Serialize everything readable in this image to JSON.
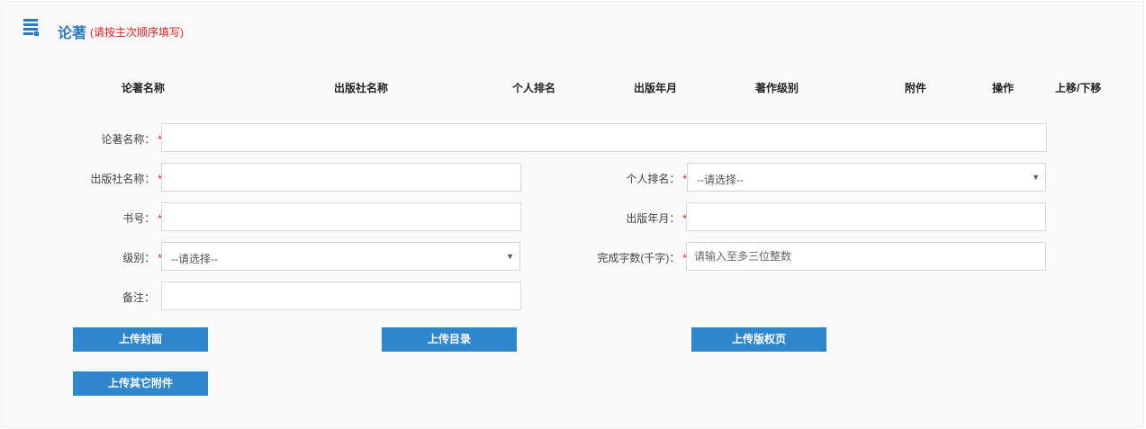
{
  "section": {
    "title": "论著",
    "subtitle": "(请按主次顺序填写)"
  },
  "table": {
    "columns": [
      "论著名称",
      "出版社名称",
      "个人排名",
      "出版年月",
      "著作级别",
      "附件",
      "操作",
      "上移/下移"
    ]
  },
  "form": {
    "work_name_label": "论著名称：",
    "publisher_label": "出版社名称：",
    "book_no_label": "书号：",
    "level_label": "级别：",
    "remark_label": "备注：",
    "rank_label": "个人排名：",
    "pub_date_label": "出版年月：",
    "word_count_label": "完成字数(千字)：",
    "required_mark": "*",
    "rank_select": "--请选择--",
    "level_select": "--请选择--",
    "word_count_placeholder": "请输入至多三位整数"
  },
  "buttons": {
    "upload_cover": "上传封面",
    "upload_toc": "上传目录",
    "upload_copyright": "上传版权页",
    "upload_other": "上传其它附件"
  },
  "colors": {
    "accent": "#2e86cc",
    "title": "#2a7bc0",
    "required": "#e02020"
  }
}
